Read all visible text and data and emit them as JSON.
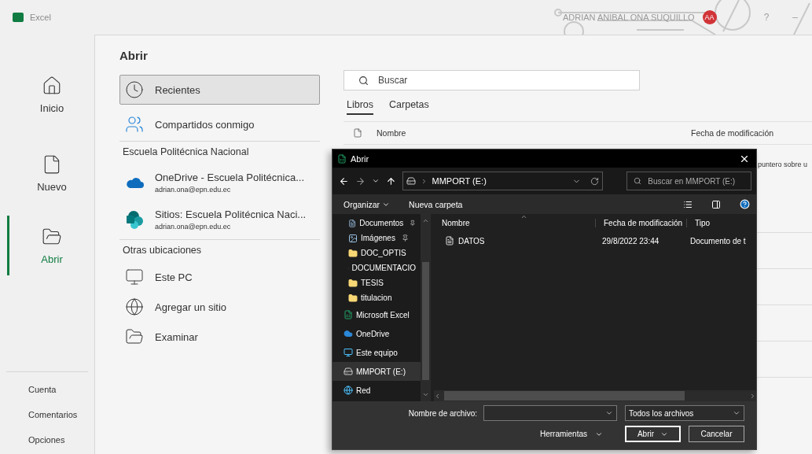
{
  "title_bar": {
    "app_name": "Excel",
    "user_name": "ADRIAN ANIBAL ONA SUQUILLO",
    "avatar_initials": "AA",
    "help": "?",
    "minimize": "–"
  },
  "nav": {
    "items": [
      {
        "label": "Inicio",
        "kind": "home",
        "selected": false
      },
      {
        "label": "Nuevo",
        "kind": "new",
        "selected": false
      },
      {
        "label": "Abrir",
        "kind": "open",
        "selected": true
      }
    ],
    "footer": [
      "Cuenta",
      "Comentarios",
      "Opciones"
    ]
  },
  "open": {
    "heading": "Abrir",
    "sections": [
      {
        "places": [
          {
            "label": "Recientes",
            "kind": "recent",
            "selected": true
          },
          {
            "label": "Compartidos conmigo",
            "kind": "shared",
            "selected": false
          }
        ]
      },
      {
        "title": "Escuela Politécnica Nacional",
        "places": [
          {
            "label": "OneDrive - Escuela Politécnica...",
            "sublabel": "adrian.ona@epn.edu.ec",
            "kind": "onedrive",
            "selected": false
          },
          {
            "label": "Sitios: Escuela Politécnica Naci...",
            "sublabel": "adrian.ona@epn.edu.ec",
            "kind": "sites",
            "selected": false
          }
        ]
      },
      {
        "title": "Otras ubicaciones",
        "places": [
          {
            "label": "Este PC",
            "kind": "pc",
            "selected": false
          },
          {
            "label": "Agregar un sitio",
            "kind": "add_site",
            "selected": false
          },
          {
            "label": "Examinar",
            "kind": "browse",
            "selected": false
          }
        ]
      }
    ]
  },
  "files": {
    "search_placeholder": "Buscar",
    "tabs": [
      {
        "label": "Libros",
        "selected": true
      },
      {
        "label": "Carpetas",
        "selected": false
      }
    ],
    "columns": [
      "Nombre",
      "Fecha de modificación"
    ],
    "hint": "puntero sobre u"
  },
  "dialog": {
    "title": "Abrir",
    "path": "MMPORT (E:)",
    "search_placeholder": "Buscar en MMPORT (E:)",
    "organize": "Organizar",
    "new_folder": "Nueva carpeta",
    "nav": [
      {
        "label": "Documentos",
        "kind": "documents",
        "pinned": true,
        "selected": false
      },
      {
        "label": "Imágenes",
        "kind": "pictures",
        "pinned": true,
        "selected": false
      },
      {
        "label": "DOC_OPTIS",
        "kind": "folder",
        "pinned": false,
        "selected": false
      },
      {
        "label": "DOCUMENTACIO",
        "kind": "folder",
        "pinned": false,
        "selected": false
      },
      {
        "label": "TESIS",
        "kind": "folder",
        "pinned": false,
        "selected": false
      },
      {
        "label": "titulacion",
        "kind": "folder",
        "pinned": false,
        "selected": false
      },
      {
        "label": "Microsoft Excel",
        "kind": "app",
        "pinned": false,
        "selected": false
      },
      {
        "label": "OneDrive",
        "kind": "cloud",
        "pinned": false,
        "selected": false
      },
      {
        "label": "Este equipo",
        "kind": "pc",
        "pinned": false,
        "selected": false
      },
      {
        "label": "MMPORT (E:)",
        "kind": "drive",
        "pinned": false,
        "selected": true
      },
      {
        "label": "Red",
        "kind": "network",
        "pinned": false,
        "selected": false
      }
    ],
    "columns": [
      "Nombre",
      "Fecha de modificación",
      "Tipo"
    ],
    "rows": [
      {
        "name": "DATOS",
        "modified": "29/8/2022 23:44",
        "type": "Documento de t"
      }
    ],
    "file_name_label": "Nombre de archivo:",
    "file_type": "Todos los archivos",
    "tools": "Herramientas",
    "open_button": "Abrir",
    "cancel_button": "Cancelar"
  }
}
